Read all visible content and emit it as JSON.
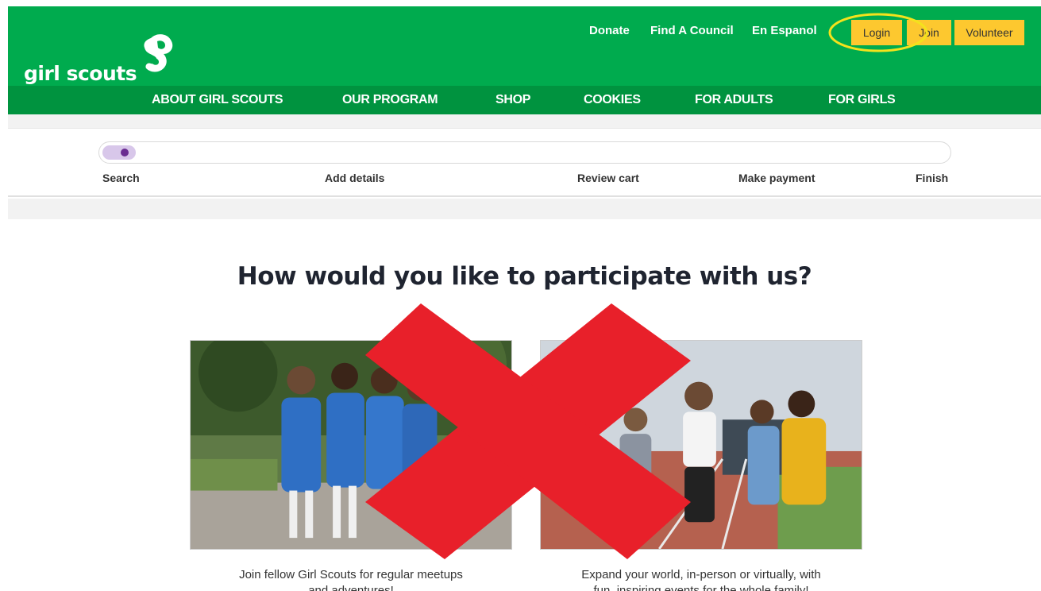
{
  "header": {
    "logo_text": "girl scouts",
    "utility_links": [
      "Donate",
      "Find A Council",
      "En Espanol"
    ],
    "buttons": {
      "login": "Login",
      "join": "Join",
      "volunteer": "Volunteer"
    }
  },
  "nav": {
    "items": [
      "ABOUT GIRL SCOUTS",
      "OUR PROGRAM",
      "SHOP",
      "COOKIES",
      "FOR ADULTS",
      "FOR GIRLS"
    ]
  },
  "progress": {
    "steps": [
      "Search",
      "Add details",
      "Review cart",
      "Make payment",
      "Finish"
    ],
    "current_step": 1
  },
  "main": {
    "headline": "How would you like to participate with us?",
    "cards": [
      {
        "caption_line1": "Join fellow Girl Scouts for regular meetups",
        "caption_line2": "and adventures!"
      },
      {
        "caption_line1": "Expand your world, in-person or virtually, with",
        "caption_line2": "fun, inspiring events for the whole family!"
      }
    ]
  },
  "colors": {
    "brand_green": "#00ab4e",
    "nav_green": "#00933f",
    "button_yellow": "#fdc82f",
    "progress_purple": "#6a2c91",
    "annotation_red": "#e8202a",
    "annotation_yellow": "#f4e21c"
  },
  "icons": {
    "logo_mark": "trefoil-profile-icon"
  }
}
